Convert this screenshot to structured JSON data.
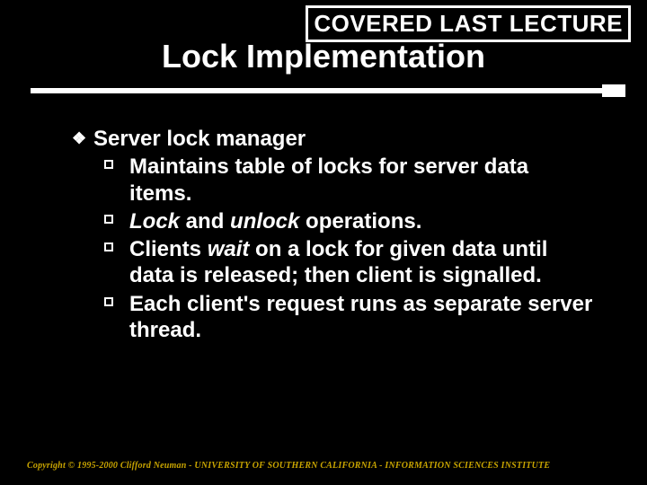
{
  "banner": "COVERED LAST LECTURE",
  "title": "Lock Implementation",
  "heading": "Server lock manager",
  "bullets": {
    "b0": "Maintains table of locks for server data items.",
    "b1_pre": "",
    "b1_lock": "Lock",
    "b1_mid": " and ",
    "b1_unlock": "unlock",
    "b1_post": " operations.",
    "b2_pre": "Clients ",
    "b2_wait": "wait",
    "b2_post": " on a lock for given data until data is released; then client is signalled.",
    "b3": "Each client's request runs as separate server thread."
  },
  "footer": "Copyright © 1995-2000 Clifford Neuman - UNIVERSITY OF SOUTHERN CALIFORNIA - INFORMATION SCIENCES INSTITUTE"
}
